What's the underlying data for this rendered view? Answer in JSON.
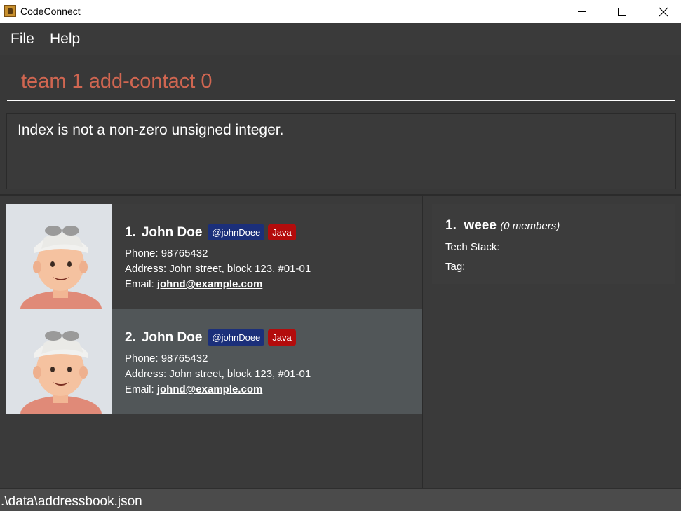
{
  "window": {
    "title": "CodeConnect"
  },
  "menu": {
    "file": "File",
    "help": "Help"
  },
  "command": {
    "value": "team 1 add-contact 0"
  },
  "result": {
    "message": "Index is not a non-zero unsigned integer."
  },
  "contacts": [
    {
      "index": "1.",
      "name": "John Doe",
      "handle": "@johnDoee",
      "skill": "Java",
      "phone_label": "Phone: 98765432",
      "address_label": "Address: John street, block 123, #01-01",
      "email_prefix": "Email: ",
      "email": "johnd@example.com"
    },
    {
      "index": "2.",
      "name": "John Doe",
      "handle": "@johnDoee",
      "skill": "Java",
      "phone_label": "Phone: 98765432",
      "address_label": "Address: John street, block 123, #01-01",
      "email_prefix": "Email: ",
      "email": "johnd@example.com"
    }
  ],
  "teams": [
    {
      "index": "1.",
      "name": "weee",
      "members": "(0 members)",
      "tech_stack_label": "Tech Stack:",
      "tag_label": "Tag:"
    }
  ],
  "status": {
    "path": ".\\data\\addressbook.json"
  },
  "colors": {
    "background": "#3a3a3a",
    "command_text": "#d06651",
    "handle_tag": "#1b2f7a",
    "skill_tag": "#b30c0c",
    "selected_card": "#515658"
  }
}
